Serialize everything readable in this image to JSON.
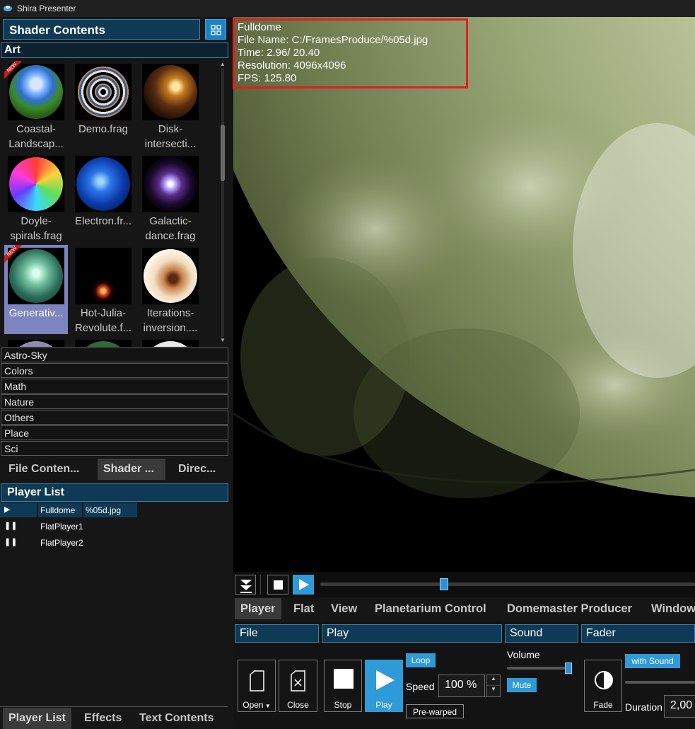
{
  "app": {
    "title": "Shira Presenter"
  },
  "left_panel": {
    "shader_header": "Shader Contents",
    "open_category": "Art",
    "thumbnails": [
      {
        "label": "Coastal-Landscap...",
        "badge": "NEW",
        "selected": false
      },
      {
        "label": "Demo.frag",
        "badge": "",
        "selected": false
      },
      {
        "label": "Disk-intersecti...",
        "badge": "",
        "selected": false
      },
      {
        "label": "Doyle-spirals.frag",
        "badge": "",
        "selected": false
      },
      {
        "label": "Electron.fr...",
        "badge": "",
        "selected": false
      },
      {
        "label": "Galactic-dance.frag",
        "badge": "",
        "selected": false
      },
      {
        "label": "Generativ...",
        "badge": "NEW",
        "selected": true
      },
      {
        "label": "Hot-Julia-Revolute.f...",
        "badge": "",
        "selected": false
      },
      {
        "label": "Iterations-inversion....",
        "badge": "",
        "selected": false
      }
    ],
    "categories": [
      "Astro-Sky",
      "Colors",
      "Math",
      "Nature",
      "Others",
      "Place",
      "Sci"
    ],
    "panel_tabs": [
      "File Conten...",
      "Shader ...",
      "Direc..."
    ],
    "active_panel_tab": "Shader ...",
    "player_list_header": "Player List",
    "players": [
      {
        "state_icon": "▶",
        "name": "Fulldome",
        "file": "%05d.jpg",
        "selected": true
      },
      {
        "state_icon": "❚❚",
        "name": "FlatPlayer1",
        "file": "",
        "selected": false
      },
      {
        "state_icon": "❚❚",
        "name": "FlatPlayer2",
        "file": "",
        "selected": false
      }
    ],
    "bottom_tabs": [
      "Player List",
      "Effects",
      "Text Contents"
    ],
    "active_bottom_tab": "Player List"
  },
  "viewport": {
    "overlay_lines": [
      "Fulldome",
      "File Name: C:/FramesProduce/%05d.jpg",
      "Time: 2.96/ 20.40",
      "Resolution: 4096x4096",
      "FPS: 125.80"
    ],
    "seek_fraction": 0.33
  },
  "main_tabs": [
    "Player",
    "Flat",
    "View",
    "Planetarium Control",
    "Domemaster Producer",
    "Window"
  ],
  "active_main_tab": "Player",
  "controls": {
    "sections": {
      "file": "File",
      "play": "Play",
      "sound": "Sound",
      "fader": "Fader"
    },
    "open_label": "Open",
    "close_label": "Close",
    "stop_label": "Stop",
    "play_label": "Play",
    "loop_label": "Loop",
    "speed_label": "Speed",
    "speed_value": "100 %",
    "prewarped_label": "Pre-warped",
    "volume_label": "Volume",
    "volume_fraction": 0.95,
    "mute_label": "Mute",
    "fade_label": "Fade",
    "with_sound_label": "with Sound",
    "duration_label": "Duration",
    "duration_value": "2,00"
  },
  "colors": {
    "accent": "#2f9ad8",
    "header_bg": "#0f3a55",
    "highlight": "#e01f1f",
    "selection": "#7d84bf"
  }
}
